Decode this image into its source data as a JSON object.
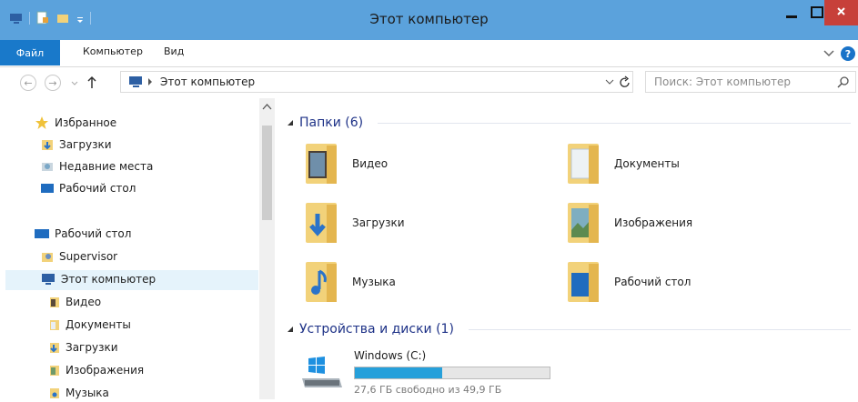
{
  "window": {
    "title": "Этот компьютер"
  },
  "ribbon": {
    "tabs": [
      "Файл",
      "Компьютер",
      "Вид"
    ]
  },
  "address": {
    "path": "Этот компьютер",
    "search_placeholder": "Поиск: Этот компьютер"
  },
  "nav": {
    "favorites_header": "Избранное",
    "favorites": [
      "Загрузки",
      "Недавние места",
      "Рабочий стол"
    ],
    "desktop_header": "Рабочий стол",
    "user": "Supervisor",
    "this_pc": "Этот компьютер",
    "pc_children": [
      "Видео",
      "Документы",
      "Загрузки",
      "Изображения",
      "Музыка"
    ]
  },
  "main": {
    "folders_header": "Папки (6)",
    "folders": [
      "Видео",
      "Документы",
      "Загрузки",
      "Изображения",
      "Музыка",
      "Рабочий стол"
    ],
    "devices_header": "Устройства и диски (1)",
    "drive": {
      "name": "Windows (C:)",
      "free_text": "27,6 ГБ свободно из 49,9 ГБ",
      "used_fraction": 0.447
    }
  },
  "colors": {
    "titlebar": "#5ba2dc",
    "accent": "#1979ca",
    "close": "#c7403a",
    "drive_fill": "#26a0da"
  }
}
